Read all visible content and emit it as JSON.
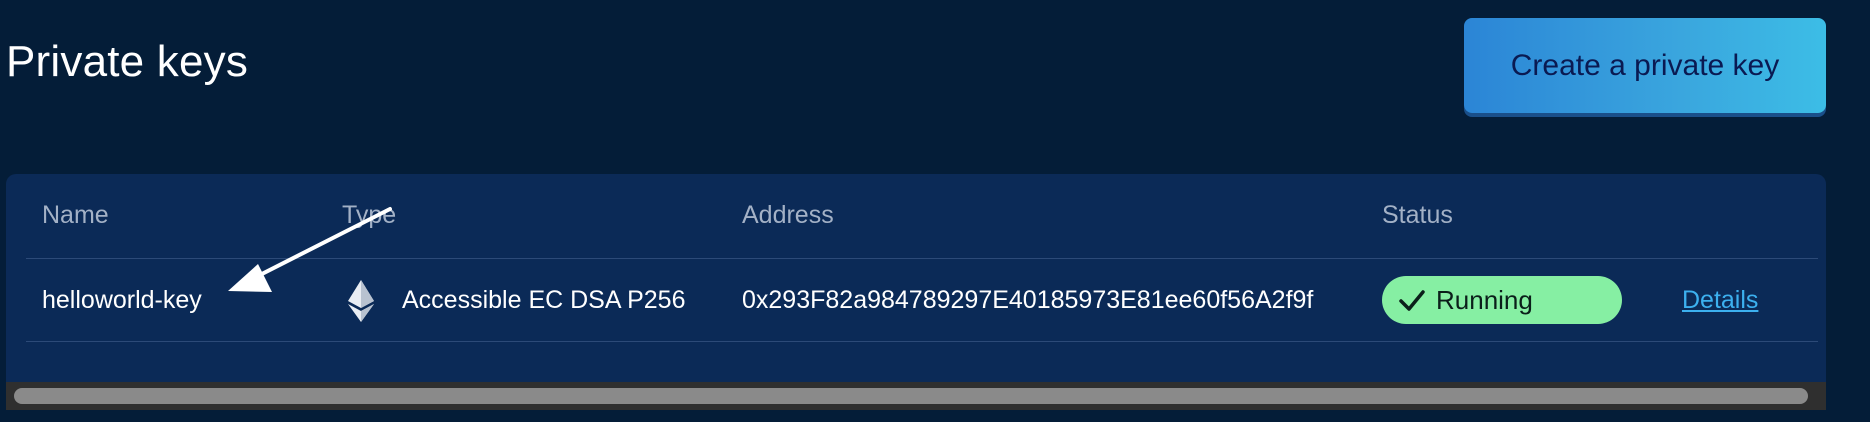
{
  "header": {
    "title": "Private keys",
    "create_button_label": "Create a private key"
  },
  "table": {
    "columns": [
      "Name",
      "Type",
      "Address",
      "Status"
    ],
    "rows": [
      {
        "name": "helloworld-key",
        "type_icon": "ethereum-icon",
        "type": "Accessible EC DSA P256",
        "address": "0x293F82a984789297E40185973E81ee60f56A2f9f",
        "status": "Running",
        "status_icon": "check-icon",
        "action": "Details"
      }
    ]
  },
  "colors": {
    "background": "#041d38",
    "panel": "#0b2a57",
    "accent": "#3aa6de",
    "status_running": "#86efa3",
    "link": "#3cb0ef"
  }
}
